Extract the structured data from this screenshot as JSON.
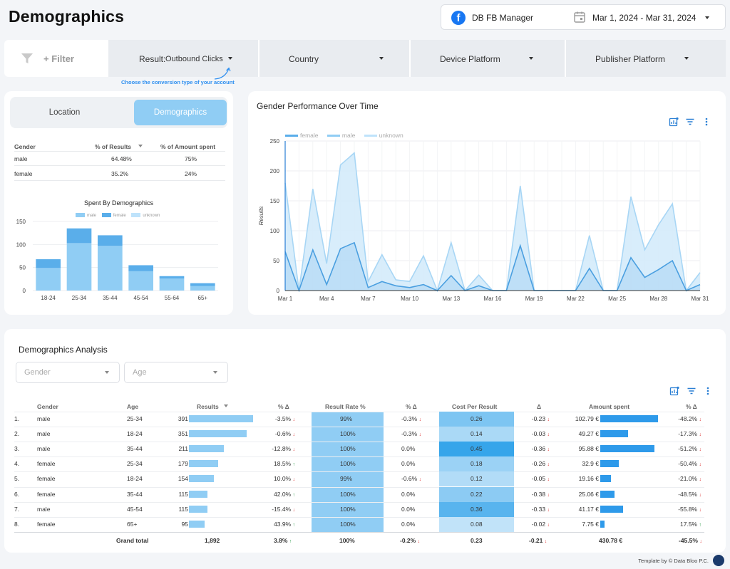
{
  "page": {
    "title": "Demographics"
  },
  "account": {
    "name": "DB FB Manager",
    "date_range": "Mar 1, 2024 - Mar 31, 2024"
  },
  "filters": {
    "add_label": "+ Filter",
    "result_prefix": "Result:",
    "result_value": "Outbound Clicks",
    "country": "Country",
    "device": "Device Platform",
    "publisher": "Publisher Platform",
    "hint": "Choose the conversion type of your account"
  },
  "tabs": {
    "location": "Location",
    "demographics": "Demographics"
  },
  "gender_table": {
    "headers": [
      "Gender",
      "% of Results",
      "% of Amount spent"
    ],
    "rows": [
      {
        "gender": "male",
        "results": "64.48%",
        "spent": "75%"
      },
      {
        "gender": "female",
        "results": "35.2%",
        "spent": "24%"
      }
    ]
  },
  "colors": {
    "male": "#90cdf4",
    "female": "#5aaeea",
    "unknown": "#bfe3fb",
    "accent": "#2e8ff0"
  },
  "chart_data": [
    {
      "type": "bar",
      "title": "Spent By Demographics",
      "categories": [
        "18-24",
        "25-34",
        "35-44",
        "45-54",
        "55-64",
        "65+"
      ],
      "series": [
        {
          "name": "male",
          "values": [
            49,
            103,
            97,
            42,
            26,
            10
          ]
        },
        {
          "name": "female",
          "values": [
            19,
            32,
            23,
            13,
            5,
            6
          ]
        },
        {
          "name": "unknown",
          "values": [
            0,
            0,
            0,
            0,
            1,
            0
          ]
        }
      ],
      "stacked": true,
      "ylim": [
        0,
        150
      ],
      "yticks": [
        0,
        50,
        100,
        150
      ],
      "legend": "top"
    },
    {
      "type": "area",
      "title": "Gender Performance Over Time",
      "ylabel": "Results",
      "x": [
        1,
        2,
        3,
        4,
        5,
        6,
        7,
        8,
        9,
        10,
        11,
        12,
        13,
        14,
        15,
        16,
        17,
        18,
        19,
        20,
        21,
        22,
        23,
        24,
        25,
        26,
        27,
        28,
        29,
        30,
        31
      ],
      "xticks": [
        "Mar 1",
        "Mar 4",
        "Mar 7",
        "Mar 10",
        "Mar 13",
        "Mar 16",
        "Mar 19",
        "Mar 22",
        "Mar 25",
        "Mar 28",
        "Mar 31"
      ],
      "ylim": [
        0,
        250
      ],
      "yticks": [
        0,
        50,
        100,
        150,
        200,
        250
      ],
      "stacked": true,
      "series": [
        {
          "name": "female",
          "values": [
            65,
            0,
            68,
            10,
            70,
            80,
            5,
            15,
            8,
            5,
            10,
            0,
            25,
            0,
            8,
            0,
            0,
            75,
            0,
            0,
            0,
            0,
            37,
            0,
            0,
            55,
            22,
            35,
            50,
            0,
            10
          ]
        },
        {
          "name": "male",
          "values": [
            115,
            0,
            102,
            35,
            140,
            150,
            10,
            45,
            10,
            10,
            48,
            0,
            55,
            0,
            18,
            0,
            0,
            100,
            0,
            0,
            0,
            0,
            55,
            0,
            0,
            102,
            46,
            75,
            95,
            0,
            20
          ]
        },
        {
          "name": "unknown",
          "values": [
            0,
            0,
            0,
            0,
            0,
            2,
            1,
            0,
            0,
            2,
            0,
            0,
            0,
            0,
            0,
            0,
            0,
            0,
            0,
            0,
            0,
            0,
            0,
            0,
            0,
            0,
            0,
            0,
            0,
            0,
            0
          ]
        }
      ],
      "legend": "top-left"
    }
  ],
  "analysis": {
    "title": "Demographics Analysis",
    "gender_placeholder": "Gender",
    "age_placeholder": "Age",
    "headers": [
      "Gender",
      "Age",
      "Results",
      "% Δ",
      "Result Rate %",
      "% Δ",
      "Cost Per Result",
      "Δ",
      "Amount spent",
      "% Δ"
    ],
    "rows": [
      {
        "n": "1.",
        "gender": "male",
        "age": "25-34",
        "results": 391,
        "results_d": "-3.5%",
        "results_dir": "down",
        "rate": "99%",
        "rate_d": "-0.3%",
        "rate_dir": "down",
        "cpr": "0.26",
        "cpr_v": 0.26,
        "cpr_d": "-0.23",
        "cpr_dir": "down",
        "spent": "102.79 €",
        "spent_v": 102.79,
        "spent_d": "-48.2%",
        "spent_dir": "down"
      },
      {
        "n": "2.",
        "gender": "male",
        "age": "18-24",
        "results": 351,
        "results_d": "-0.6%",
        "results_dir": "down",
        "rate": "100%",
        "rate_d": "-0.3%",
        "rate_dir": "down",
        "cpr": "0.14",
        "cpr_v": 0.14,
        "cpr_d": "-0.03",
        "cpr_dir": "down",
        "spent": "49.27 €",
        "spent_v": 49.27,
        "spent_d": "-17.3%",
        "spent_dir": "down"
      },
      {
        "n": "3.",
        "gender": "male",
        "age": "35-44",
        "results": 211,
        "results_d": "-12.8%",
        "results_dir": "down",
        "rate": "100%",
        "rate_d": "0.0%",
        "rate_dir": "",
        "cpr": "0.45",
        "cpr_v": 0.45,
        "cpr_d": "-0.36",
        "cpr_dir": "down",
        "spent": "95.88 €",
        "spent_v": 95.88,
        "spent_d": "-51.2%",
        "spent_dir": "down"
      },
      {
        "n": "4.",
        "gender": "female",
        "age": "25-34",
        "results": 179,
        "results_d": "18.5%",
        "results_dir": "up",
        "rate": "100%",
        "rate_d": "0.0%",
        "rate_dir": "",
        "cpr": "0.18",
        "cpr_v": 0.18,
        "cpr_d": "-0.26",
        "cpr_dir": "down",
        "spent": "32.9 €",
        "spent_v": 32.9,
        "spent_d": "-50.4%",
        "spent_dir": "down"
      },
      {
        "n": "5.",
        "gender": "female",
        "age": "18-24",
        "results": 154,
        "results_d": "10.0%",
        "results_dir": "down",
        "rate": "99%",
        "rate_d": "-0.6%",
        "rate_dir": "down",
        "cpr": "0.12",
        "cpr_v": 0.12,
        "cpr_d": "-0.05",
        "cpr_dir": "down",
        "spent": "19.16 €",
        "spent_v": 19.16,
        "spent_d": "-21.0%",
        "spent_dir": "down"
      },
      {
        "n": "6.",
        "gender": "female",
        "age": "35-44",
        "results": 115,
        "results_d": "42.0%",
        "results_dir": "up",
        "rate": "100%",
        "rate_d": "0.0%",
        "rate_dir": "",
        "cpr": "0.22",
        "cpr_v": 0.22,
        "cpr_d": "-0.38",
        "cpr_dir": "down",
        "spent": "25.06 €",
        "spent_v": 25.06,
        "spent_d": "-48.5%",
        "spent_dir": "down"
      },
      {
        "n": "7.",
        "gender": "male",
        "age": "45-54",
        "results": 115,
        "results_d": "-15.4%",
        "results_dir": "down",
        "rate": "100%",
        "rate_d": "0.0%",
        "rate_dir": "",
        "cpr": "0.36",
        "cpr_v": 0.36,
        "cpr_d": "-0.33",
        "cpr_dir": "down",
        "spent": "41.17 €",
        "spent_v": 41.17,
        "spent_d": "-55.8%",
        "spent_dir": "down"
      },
      {
        "n": "8.",
        "gender": "female",
        "age": "65+",
        "results": 95,
        "results_d": "43.9%",
        "results_dir": "up",
        "rate": "100%",
        "rate_d": "0.0%",
        "rate_dir": "",
        "cpr": "0.08",
        "cpr_v": 0.08,
        "cpr_d": "-0.02",
        "cpr_dir": "down",
        "spent": "7.75 €",
        "spent_v": 7.75,
        "spent_d": "17.5%",
        "spent_dir": "up"
      }
    ],
    "total": {
      "label": "Grand total",
      "results": "1,892",
      "results_d": "3.8%",
      "results_dir": "up",
      "rate": "100%",
      "rate_d": "-0.2%",
      "rate_dir": "down",
      "cpr": "0.23",
      "cpr_d": "-0.21",
      "cpr_dir": "down",
      "spent": "430.78 €",
      "spent_d": "-45.5%",
      "spent_dir": "down"
    }
  },
  "footer": "Template by © Data Bloo P.C."
}
